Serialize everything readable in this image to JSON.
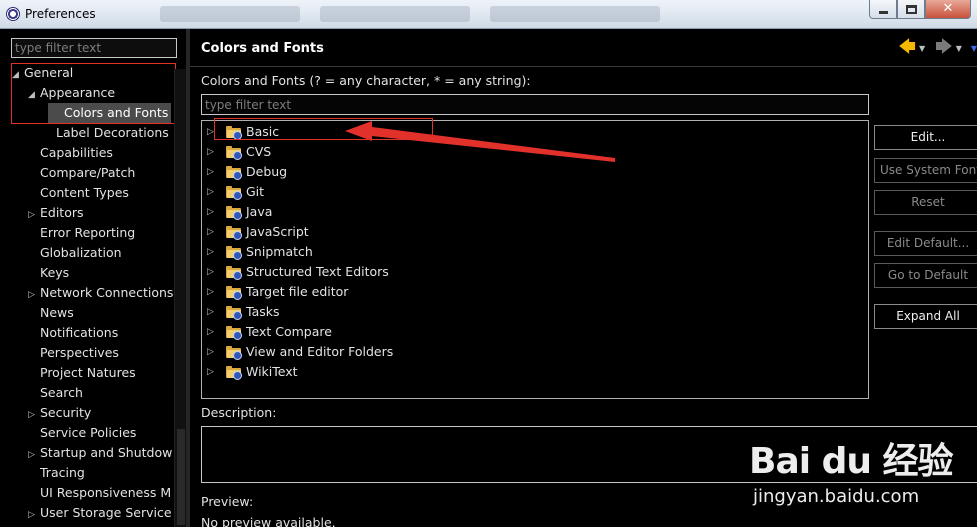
{
  "window": {
    "title": "Preferences"
  },
  "left": {
    "filter_placeholder": "type filter text",
    "items": [
      {
        "label": "General",
        "twisty": "◢",
        "indent": 0
      },
      {
        "label": "Appearance",
        "twisty": "◢",
        "indent": 1
      },
      {
        "label": "Colors and Fonts",
        "twisty": "",
        "indent": 2,
        "selected": true
      },
      {
        "label": "Label Decorations",
        "twisty": "",
        "indent": 2
      },
      {
        "label": "Capabilities",
        "twisty": "",
        "indent": 1
      },
      {
        "label": "Compare/Patch",
        "twisty": "",
        "indent": 1
      },
      {
        "label": "Content Types",
        "twisty": "",
        "indent": 1
      },
      {
        "label": "Editors",
        "twisty": "▷",
        "indent": 1
      },
      {
        "label": "Error Reporting",
        "twisty": "",
        "indent": 1
      },
      {
        "label": "Globalization",
        "twisty": "",
        "indent": 1
      },
      {
        "label": "Keys",
        "twisty": "",
        "indent": 1
      },
      {
        "label": "Network Connections",
        "twisty": "▷",
        "indent": 1
      },
      {
        "label": "News",
        "twisty": "",
        "indent": 1
      },
      {
        "label": "Notifications",
        "twisty": "",
        "indent": 1
      },
      {
        "label": "Perspectives",
        "twisty": "",
        "indent": 1
      },
      {
        "label": "Project Natures",
        "twisty": "",
        "indent": 1
      },
      {
        "label": "Search",
        "twisty": "",
        "indent": 1
      },
      {
        "label": "Security",
        "twisty": "▷",
        "indent": 1
      },
      {
        "label": "Service Policies",
        "twisty": "",
        "indent": 1
      },
      {
        "label": "Startup and Shutdow",
        "twisty": "▷",
        "indent": 1
      },
      {
        "label": "Tracing",
        "twisty": "",
        "indent": 1
      },
      {
        "label": "UI Responsiveness M",
        "twisty": "",
        "indent": 1
      },
      {
        "label": "User Storage Service",
        "twisty": "▷",
        "indent": 1
      }
    ]
  },
  "page": {
    "title": "Colors and Fonts",
    "hint": "Colors and Fonts (? = any character, * = any string):",
    "filter_placeholder": "type filter text",
    "categories": [
      "Basic",
      "CVS",
      "Debug",
      "Git",
      "Java",
      "JavaScript",
      "Snipmatch",
      "Structured Text Editors",
      "Target file editor",
      "Tasks",
      "Text Compare",
      "View and Editor Folders",
      "WikiText"
    ],
    "twisty": "▷",
    "buttons": {
      "edit": "Edit...",
      "use_system_font": "Use System Font",
      "reset": "Reset",
      "edit_default": "Edit Default...",
      "go_to_default": "Go to Default",
      "expand_all": "Expand All"
    },
    "description_label": "Description:",
    "preview_label": "Preview:",
    "preview_text": "No preview available."
  },
  "nav": {
    "back": "🡄",
    "forward": "🡆",
    "dropdown": "▼",
    "menu": "▼"
  },
  "watermark": {
    "logo": "Bai du 经验",
    "url": "jingyan.baidu.com"
  },
  "colors": {
    "annotation": "#e2302b",
    "accent_back": "#f5b800",
    "menu_arrow": "#3b6be0"
  }
}
